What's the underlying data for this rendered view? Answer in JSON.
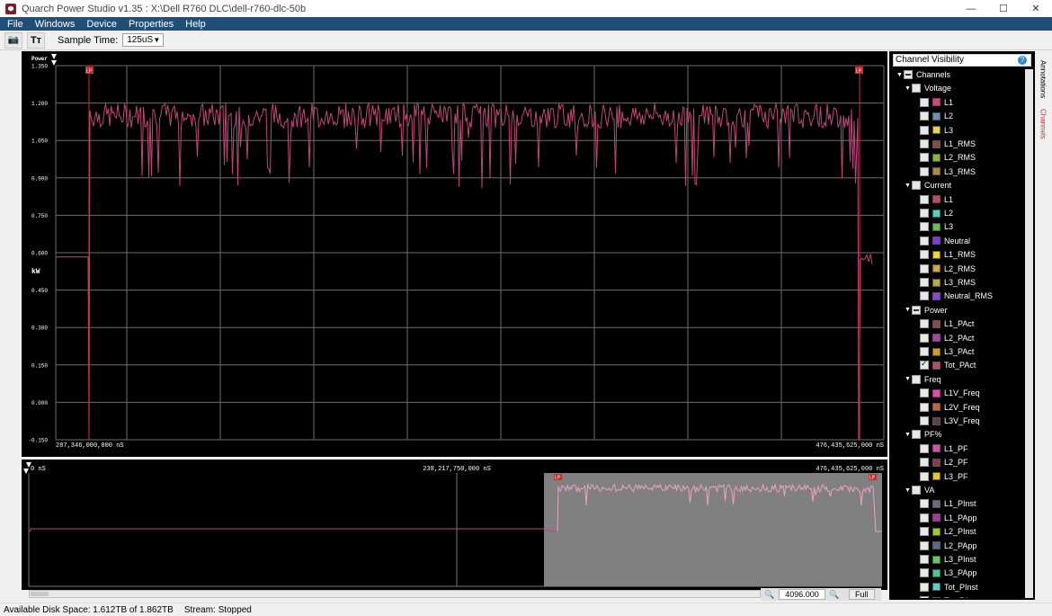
{
  "window": {
    "title": "Quarch Power Studio v1.35 : X:\\Dell R760 DLC\\dell-r760-dlc-50b",
    "minimize": "—",
    "maximize": "☐",
    "close": "✕"
  },
  "menu": {
    "items": [
      {
        "label": "File"
      },
      {
        "label": "Windows"
      },
      {
        "label": "Device"
      },
      {
        "label": "Properties"
      },
      {
        "label": "Help"
      }
    ]
  },
  "toolbar": {
    "camera_glyph": "📷",
    "text_glyph": "Tт",
    "sample_time_label": "Sample Time:",
    "sample_time_value": "125uS"
  },
  "main_plot": {
    "channel_title": "Power",
    "unit_label": "kW",
    "y_ticks": [
      "1.350",
      "1.200",
      "1.050",
      "0.900",
      "0.750",
      "0.600",
      "0.450",
      "0.300",
      "0.150",
      "0.000",
      "-0.150"
    ],
    "x_start_label": "287,346,000,000 nS",
    "x_end_label": "476,435,625,000 nS",
    "marker_start": "LP",
    "marker_end": "LP",
    "trace_color": "#c0467a",
    "grid_color": "#6e6e6e",
    "marker_color": "#d42b2b"
  },
  "overview": {
    "x_start_label": "0 nS",
    "x_mid_label": "238,217,750,000 nS",
    "x_end_label": "476,435,625,000 nS",
    "marker_start": "LP",
    "marker_end": "LP",
    "selection_color": "#808080"
  },
  "zoom": {
    "zoom_out_glyph": "🔍",
    "value": "4096.000",
    "zoom_in_glyph": "🔍",
    "full_label": "Full"
  },
  "status": {
    "disk_space": "Available Disk Space: 1.612TB of 1.862TB",
    "stream": "Stream:  Stopped"
  },
  "panel": {
    "title": "Channel Visibility",
    "help_glyph": "?",
    "tree": [
      {
        "level": 0,
        "label": "Channels",
        "caret": "▼",
        "state": "part"
      },
      {
        "level": 1,
        "label": "Voltage",
        "caret": "▼",
        "state": "none"
      },
      {
        "level": 2,
        "label": "L1",
        "state": "none",
        "color": "#d0457f"
      },
      {
        "level": 2,
        "label": "L2",
        "state": "none",
        "color": "#6f8fb8"
      },
      {
        "level": 2,
        "label": "L3",
        "state": "none",
        "color": "#e6d73a"
      },
      {
        "level": 2,
        "label": "L1_RMS",
        "state": "none",
        "color": "#8b4a4a"
      },
      {
        "level": 2,
        "label": "L2_RMS",
        "state": "none",
        "color": "#8fb33a"
      },
      {
        "level": 2,
        "label": "L3_RMS",
        "state": "none",
        "color": "#b08a3a"
      },
      {
        "level": 1,
        "label": "Current",
        "caret": "▼",
        "state": "none"
      },
      {
        "level": 2,
        "label": "L1",
        "state": "none",
        "color": "#b84a6a"
      },
      {
        "level": 2,
        "label": "L2",
        "state": "none",
        "color": "#52d0c6"
      },
      {
        "level": 2,
        "label": "L3",
        "state": "none",
        "color": "#5ec44a"
      },
      {
        "level": 2,
        "label": "Neutral",
        "state": "none",
        "color": "#7a3fd0"
      },
      {
        "level": 2,
        "label": "L1_RMS",
        "state": "none",
        "color": "#e6d73a"
      },
      {
        "level": 2,
        "label": "L2_RMS",
        "state": "none",
        "color": "#d6a43a"
      },
      {
        "level": 2,
        "label": "L3_RMS",
        "state": "none",
        "color": "#c0a43a"
      },
      {
        "level": 2,
        "label": "Neutral_RMS",
        "state": "none",
        "color": "#8a4ad0"
      },
      {
        "level": 1,
        "label": "Power",
        "caret": "▼",
        "state": "part"
      },
      {
        "level": 2,
        "label": "L1_PAct",
        "state": "none",
        "color": "#8b4a4a"
      },
      {
        "level": 2,
        "label": "L2_PAct",
        "state": "none",
        "color": "#a04aa0"
      },
      {
        "level": 2,
        "label": "L3_PAct",
        "state": "none",
        "color": "#c89a3a"
      },
      {
        "level": 2,
        "label": "Tot_PAct",
        "state": "chk",
        "color": "#b84a6a"
      },
      {
        "level": 1,
        "label": "Freq",
        "caret": "▼",
        "state": "none"
      },
      {
        "level": 2,
        "label": "L1V_Freq",
        "state": "none",
        "color": "#e04ab0"
      },
      {
        "level": 2,
        "label": "L2V_Freq",
        "state": "none",
        "color": "#d0603a"
      },
      {
        "level": 2,
        "label": "L3V_Freq",
        "state": "none",
        "color": "#6a3a4a"
      },
      {
        "level": 1,
        "label": "PF%",
        "caret": "▼",
        "state": "none"
      },
      {
        "level": 2,
        "label": "L1_PF",
        "state": "none",
        "color": "#e04ab0"
      },
      {
        "level": 2,
        "label": "L2_PF",
        "state": "none",
        "color": "#8b3a4a"
      },
      {
        "level": 2,
        "label": "L3_PF",
        "state": "none",
        "color": "#e6c43a"
      },
      {
        "level": 1,
        "label": "VA",
        "caret": "▼",
        "state": "none"
      },
      {
        "level": 2,
        "label": "L1_PInst",
        "state": "none",
        "color": "#6a6a7a"
      },
      {
        "level": 2,
        "label": "L1_PApp",
        "state": "none",
        "color": "#a03aa0"
      },
      {
        "level": 2,
        "label": "L2_PInst",
        "state": "none",
        "color": "#a0c43a"
      },
      {
        "level": 2,
        "label": "L2_PApp",
        "state": "none",
        "color": "#5a6a8a"
      },
      {
        "level": 2,
        "label": "L3_PInst",
        "state": "none",
        "color": "#5ad04a"
      },
      {
        "level": 2,
        "label": "L3_PApp",
        "state": "none",
        "color": "#4ac49a"
      },
      {
        "level": 2,
        "label": "Tot_PInst",
        "state": "none",
        "color": "#5ad0d0"
      },
      {
        "level": 2,
        "label": "Tot_PApp",
        "state": "none",
        "color": "#7a7ad0"
      }
    ]
  },
  "side_tabs": {
    "annotations": "Annotations",
    "channels": "Channels"
  }
}
